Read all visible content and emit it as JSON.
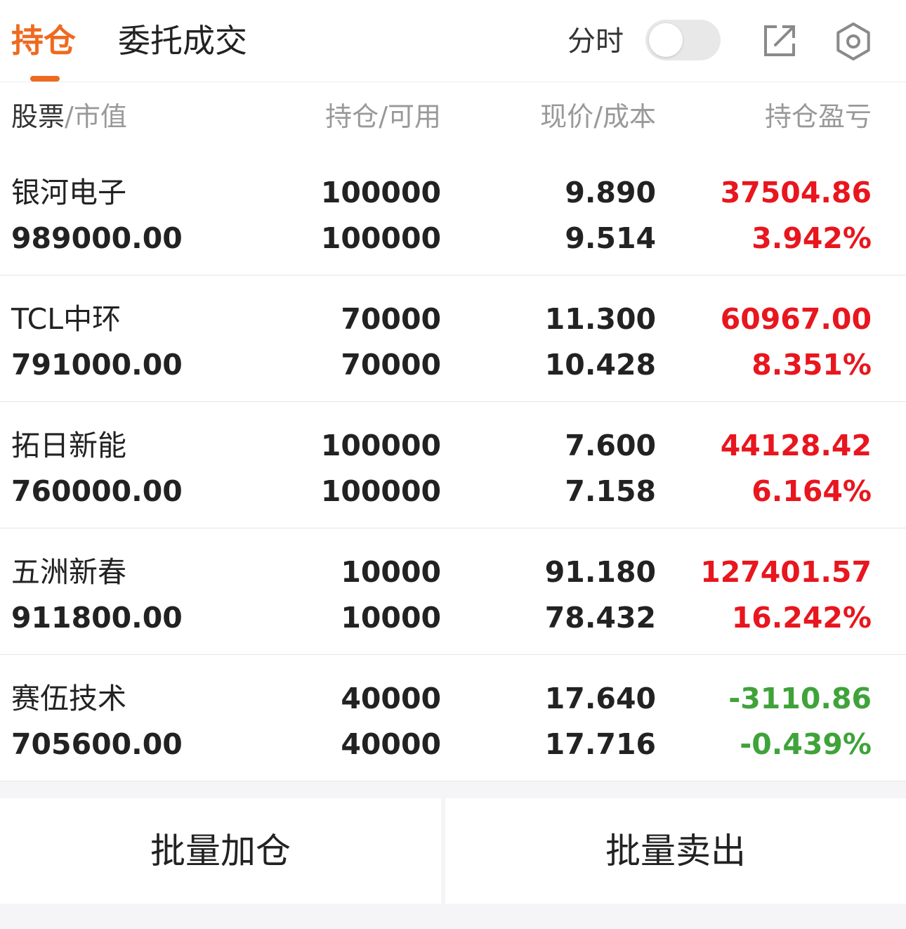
{
  "tabs": {
    "holdings": "持仓",
    "orders": "委托成交"
  },
  "header_controls": {
    "timeshare_label": "分时",
    "timeshare_on": false
  },
  "columns": {
    "stock": "股票",
    "market_value": "/市值",
    "position": "持仓",
    "available": "/可用",
    "price": "现价",
    "cost": "/成本",
    "pl": "持仓盈亏"
  },
  "colors": {
    "accent": "#ee6a1f",
    "gain": "#e8161e",
    "loss": "#3fa33a"
  },
  "holdings": [
    {
      "name": "银河电子",
      "market_value": "989000.00",
      "position": "100000",
      "available": "100000",
      "price": "9.890",
      "cost": "9.514",
      "pl": "37504.86",
      "pl_pct": "3.942%",
      "trend": "gain"
    },
    {
      "name": "TCL中环",
      "market_value": "791000.00",
      "position": "70000",
      "available": "70000",
      "price": "11.300",
      "cost": "10.428",
      "pl": "60967.00",
      "pl_pct": "8.351%",
      "trend": "gain"
    },
    {
      "name": "拓日新能",
      "market_value": "760000.00",
      "position": "100000",
      "available": "100000",
      "price": "7.600",
      "cost": "7.158",
      "pl": "44128.42",
      "pl_pct": "6.164%",
      "trend": "gain"
    },
    {
      "name": "五洲新春",
      "market_value": "911800.00",
      "position": "10000",
      "available": "10000",
      "price": "91.180",
      "cost": "78.432",
      "pl": "127401.57",
      "pl_pct": "16.242%",
      "trend": "gain"
    },
    {
      "name": "赛伍技术",
      "market_value": "705600.00",
      "position": "40000",
      "available": "40000",
      "price": "17.640",
      "cost": "17.716",
      "pl": "-3110.86",
      "pl_pct": "-0.439%",
      "trend": "loss"
    }
  ],
  "actions": {
    "batch_add": "批量加仓",
    "batch_sell": "批量卖出"
  },
  "icons": {
    "export": "external-link-icon",
    "settings": "gear-icon"
  }
}
